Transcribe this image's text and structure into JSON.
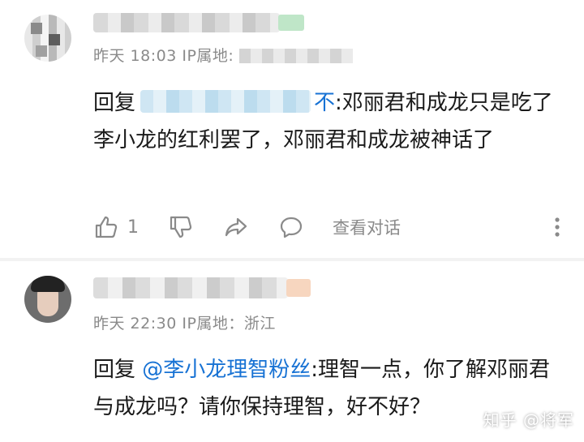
{
  "comments": [
    {
      "time": "昨天 18:03",
      "ip_label": "IP属地:",
      "reply_prefix": "回复",
      "mention_tail": "不",
      "text": ":邓丽君和成龙只是吃了李小龙的红利罢了，邓丽君和成龙被神话了",
      "like_count": "1",
      "view_conversation": "查看对话"
    },
    {
      "time": "昨天 22:30",
      "ip_label": "IP属地：",
      "ip_location": "浙江",
      "reply_prefix": "回复",
      "mention": "@李小龙理智粉丝",
      "text": ":理智一点，你了解邓丽君与成龙吗？请你保持理智，好不好？"
    }
  ],
  "watermark": "知乎 @将军",
  "icons": {
    "like": "thumbs-up-icon",
    "dislike": "thumbs-down-icon",
    "share": "share-arrow-icon",
    "reply": "chat-bubble-icon",
    "more": "more-vertical-icon"
  },
  "colors": {
    "mention": "#1772d4",
    "meta_text": "#8a8a8a",
    "body_text": "#1a1a1a"
  }
}
